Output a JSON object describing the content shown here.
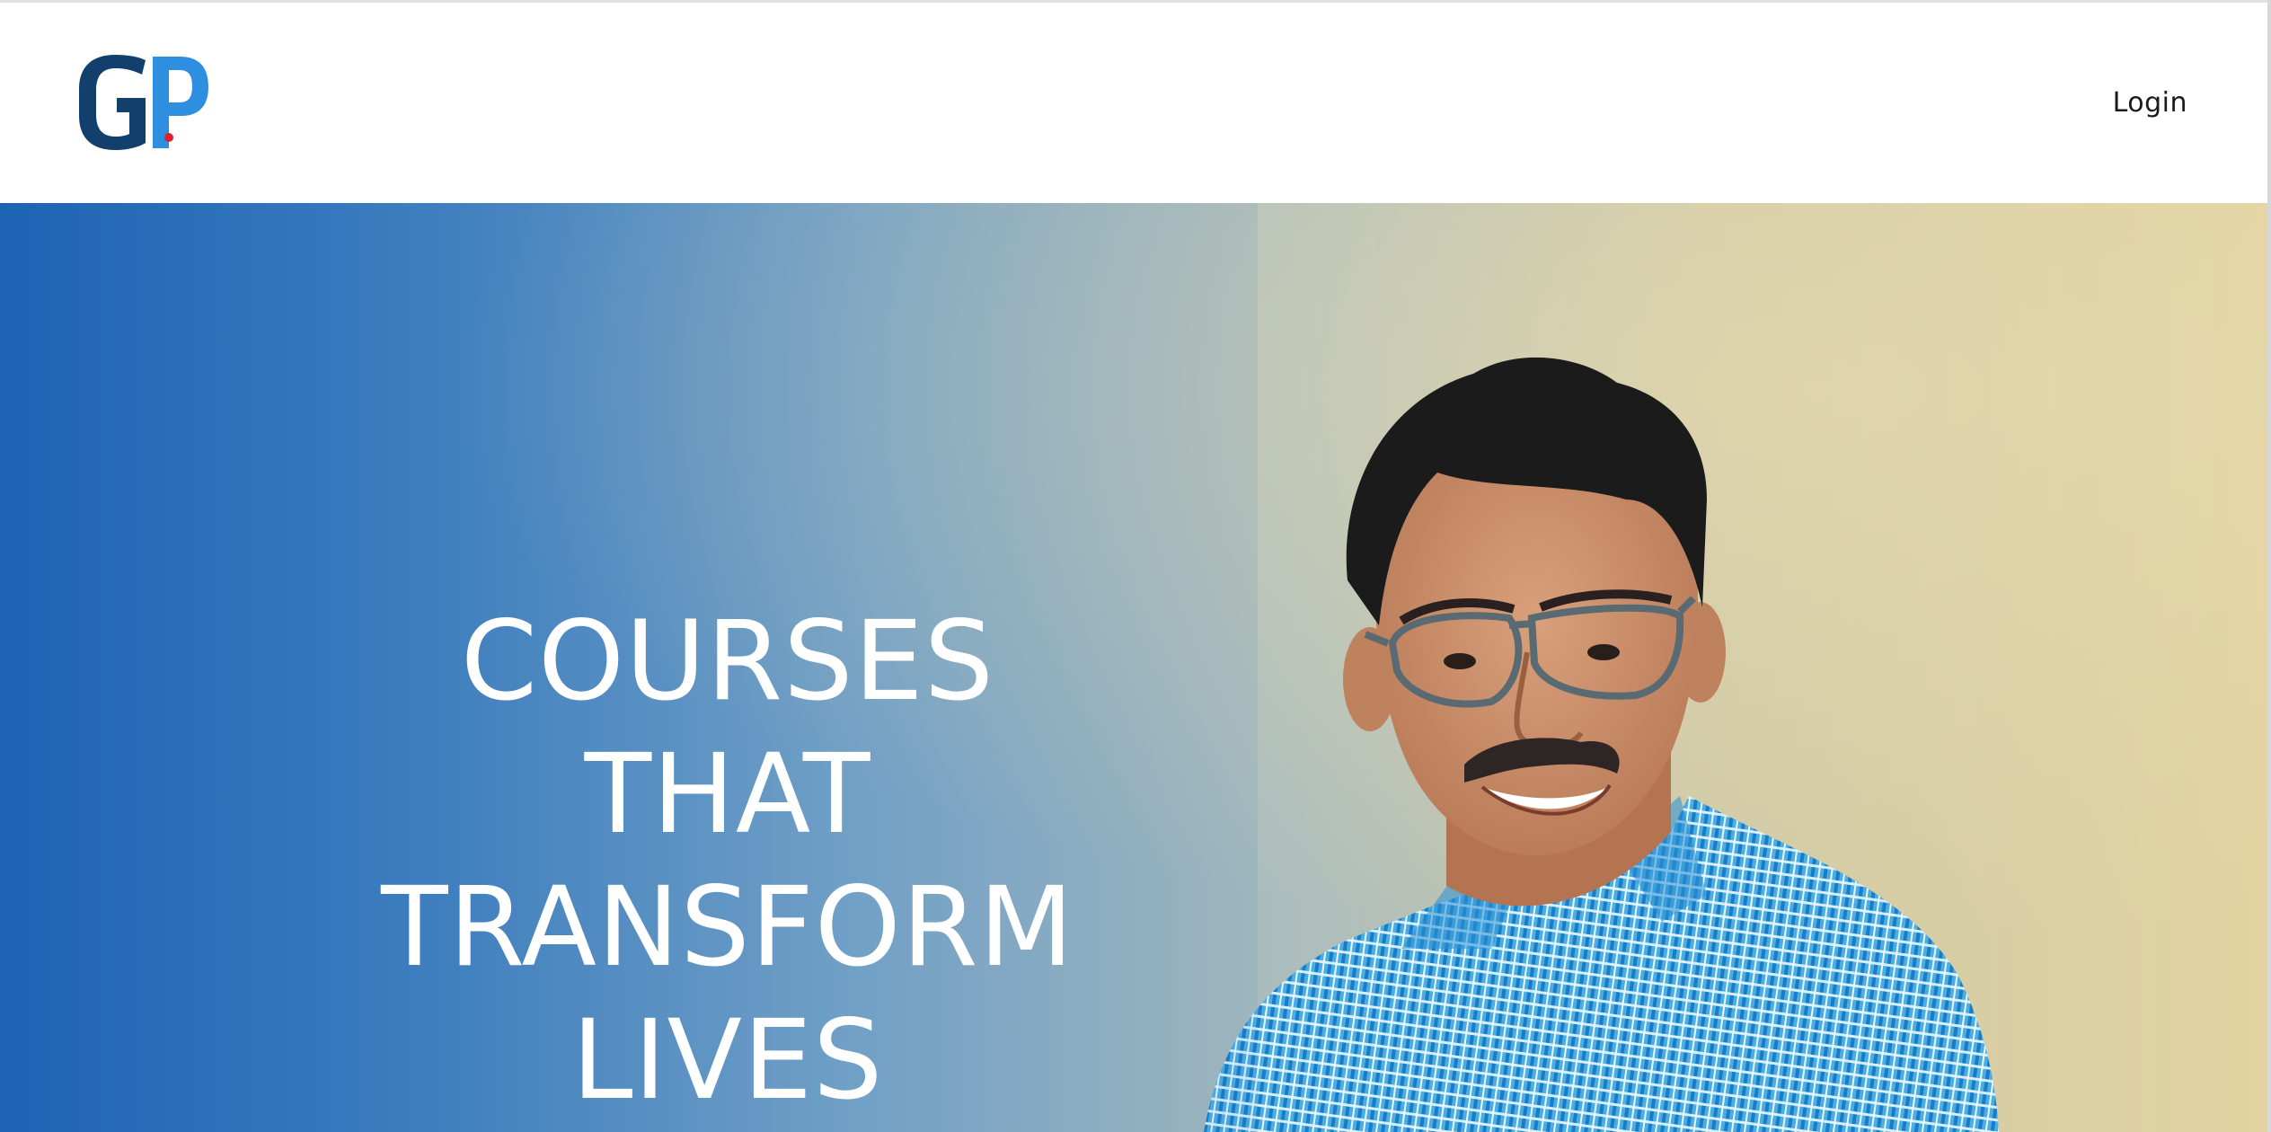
{
  "header": {
    "logo": {
      "letters": "GP",
      "colors": {
        "g": "#123f6b",
        "p": "#2e8ee0",
        "dot": "#e0202e"
      }
    },
    "login_label": "Login"
  },
  "hero": {
    "title_lines": [
      "COURSES",
      "THAT",
      "TRANSFORM",
      "LIVES"
    ],
    "colors": {
      "gradient_left": "#1e63b5",
      "gradient_mid": "#6a9bc8",
      "wall": "#d9cfa5",
      "text": "#ffffff",
      "shirt": "#3aa0dc",
      "hair": "#1b1b1b",
      "skin": "#c98e6c"
    },
    "person_image": "smiling-man-with-glasses-portrait"
  }
}
